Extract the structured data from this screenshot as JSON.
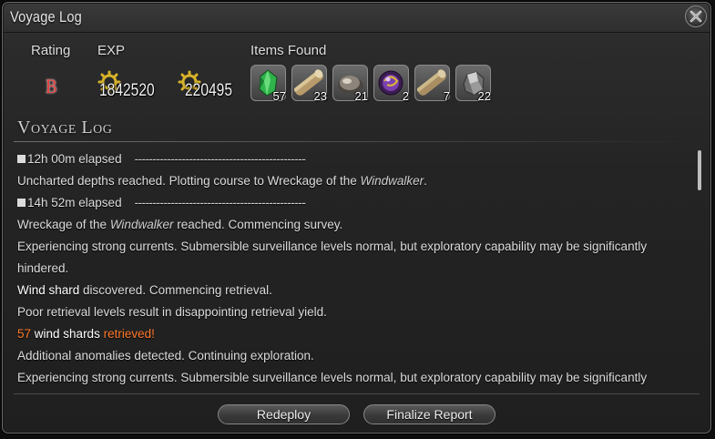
{
  "window": {
    "title": "Voyage Log"
  },
  "summary": {
    "rating_label": "Rating",
    "rating_value": "B",
    "exp_label": "EXP",
    "exp_values": [
      "1842520",
      "220495"
    ],
    "items_label": "Items Found"
  },
  "items": [
    {
      "icon": "wind-shard-icon",
      "count": "57"
    },
    {
      "icon": "lumber-icon",
      "count": "23"
    },
    {
      "icon": "ore-icon",
      "count": "21"
    },
    {
      "icon": "purple-orb-icon",
      "count": "2"
    },
    {
      "icon": "lumber-icon",
      "count": "7"
    },
    {
      "icon": "ore-icon",
      "count": "22"
    }
  ],
  "log": {
    "section_title": "Voyage Log",
    "lines": {
      "time1": "12h 00m elapsed",
      "dashes1": "-----------------------------------------------",
      "l1a": "Uncharted depths reached. Plotting course to Wreckage of the ",
      "l1b": "Windwalker",
      "l1c": ".",
      "time2": "14h 52m elapsed",
      "dashes2": "-----------------------------------------------",
      "l2a": "Wreckage of the ",
      "l2b": "Windwalker",
      "l2c": " reached. Commencing survey.",
      "l3": "Experiencing strong currents. Submersible surveillance levels normal, but exploratory capability may be significantly",
      "l3b": "hindered.",
      "l4a": "Wind shard",
      "l4b": " discovered. Commencing retrieval.",
      "l5": "Poor retrieval levels result in disappointing retrieval yield.",
      "l6a": "57",
      "l6b": " wind shards ",
      "l6c": "retrieved!",
      "l7": "Additional anomalies detected. Continuing exploration.",
      "l8": "Experiencing strong currents. Submersible surveillance levels normal, but exploratory capability may be significantly"
    }
  },
  "buttons": {
    "redeploy": "Redeploy",
    "finalize": "Finalize Report"
  },
  "colors": {
    "rating": "#e23a3a",
    "highlight": "#ff7a2a"
  }
}
